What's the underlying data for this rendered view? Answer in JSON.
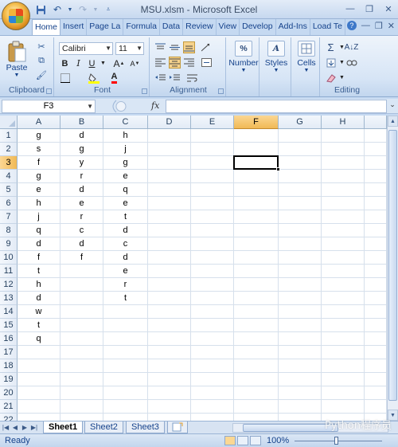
{
  "window": {
    "title": "MSU.xlsm - Microsoft Excel"
  },
  "tabs": [
    "Home",
    "Insert",
    "Page La",
    "Formula",
    "Data",
    "Review",
    "View",
    "Develop",
    "Add-Ins",
    "Load Te"
  ],
  "clipboard": {
    "paste_label": "Paste",
    "group_label": "Clipboard"
  },
  "font": {
    "name": "Calibri",
    "size": "11",
    "group_label": "Font"
  },
  "alignment": {
    "group_label": "Alignment"
  },
  "number": {
    "label": "Number",
    "icon_text": "%"
  },
  "styles": {
    "label": "Styles"
  },
  "cells": {
    "label": "Cells"
  },
  "editing": {
    "group_label": "Editing"
  },
  "formula_bar": {
    "name_box": "F3",
    "fx": "fx",
    "value": ""
  },
  "columns": [
    "A",
    "B",
    "C",
    "D",
    "E",
    "F",
    "G",
    "H"
  ],
  "selected_column": "F",
  "selected_row": 3,
  "rows": [
    {
      "n": "1",
      "A": "g",
      "B": "d",
      "C": "h"
    },
    {
      "n": "2",
      "A": "s",
      "B": "g",
      "C": "j"
    },
    {
      "n": "3",
      "A": "f",
      "B": "y",
      "C": "g"
    },
    {
      "n": "4",
      "A": "g",
      "B": "r",
      "C": "e"
    },
    {
      "n": "5",
      "A": "e",
      "B": "d",
      "C": "q"
    },
    {
      "n": "6",
      "A": "h",
      "B": "e",
      "C": "e"
    },
    {
      "n": "7",
      "A": "j",
      "B": "r",
      "C": "t"
    },
    {
      "n": "8",
      "A": "q",
      "B": "c",
      "C": "d"
    },
    {
      "n": "9",
      "A": "d",
      "B": "d",
      "C": "c"
    },
    {
      "n": "10",
      "A": "f",
      "B": "f",
      "C": "d"
    },
    {
      "n": "11",
      "A": "t",
      "B": "",
      "C": "e"
    },
    {
      "n": "12",
      "A": "h",
      "B": "",
      "C": "r"
    },
    {
      "n": "13",
      "A": "d",
      "B": "",
      "C": "t"
    },
    {
      "n": "14",
      "A": "w",
      "B": "",
      "C": ""
    },
    {
      "n": "15",
      "A": "t",
      "B": "",
      "C": ""
    },
    {
      "n": "16",
      "A": "q",
      "B": "",
      "C": ""
    },
    {
      "n": "17",
      "A": "",
      "B": "",
      "C": ""
    },
    {
      "n": "18",
      "A": "",
      "B": "",
      "C": ""
    },
    {
      "n": "19",
      "A": "",
      "B": "",
      "C": ""
    },
    {
      "n": "20",
      "A": "",
      "B": "",
      "C": ""
    },
    {
      "n": "21",
      "A": "",
      "B": "",
      "C": ""
    },
    {
      "n": "22",
      "A": "",
      "B": "",
      "C": ""
    }
  ],
  "sheets": [
    "Sheet1",
    "Sheet2",
    "Sheet3"
  ],
  "active_sheet": "Sheet1",
  "status": {
    "ready": "Ready",
    "zoom": "100%"
  },
  "watermark": "Python程序员"
}
